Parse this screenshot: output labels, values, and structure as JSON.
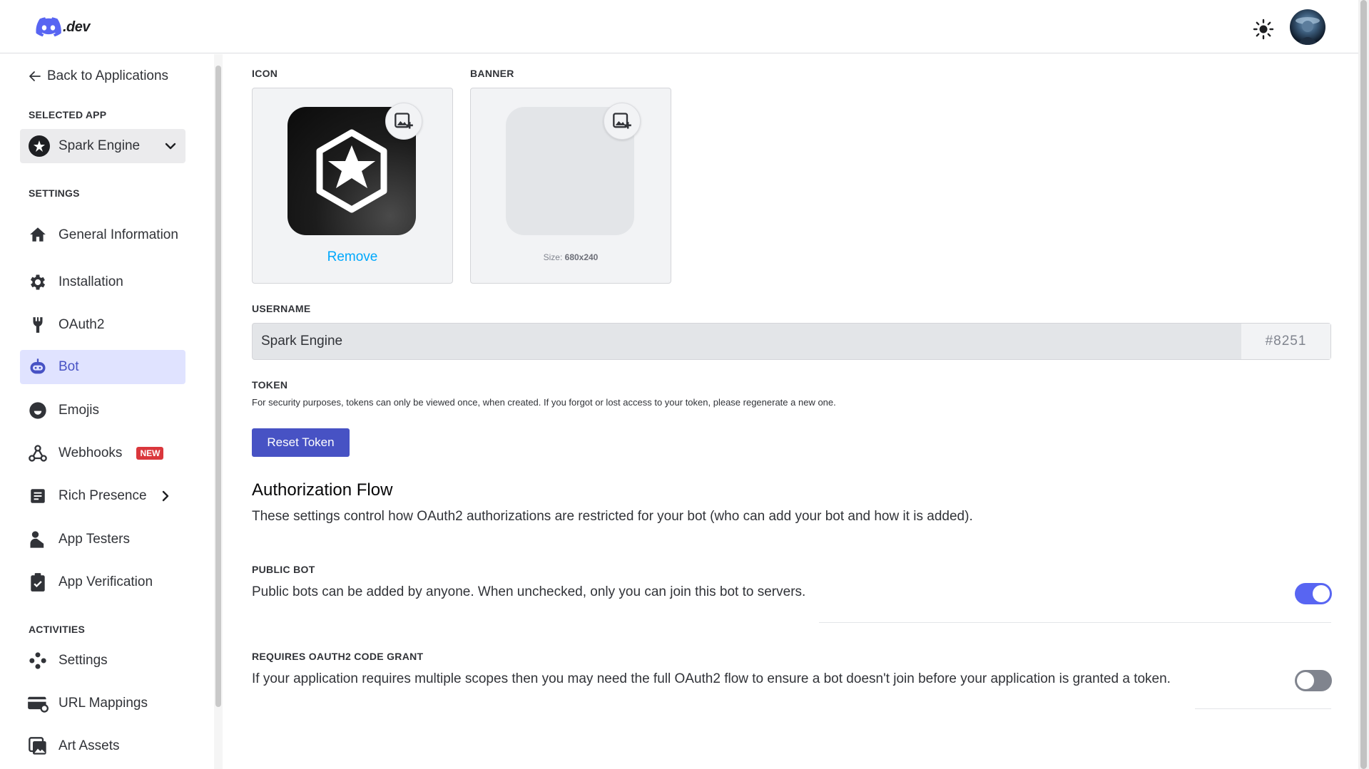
{
  "header": {
    "logo_text": ".dev"
  },
  "sidebar": {
    "back_label": "Back to Applications",
    "selected_app_label": "SELECTED APP",
    "selected_app_name": "Spark Engine",
    "settings_label": "SETTINGS",
    "activities_label": "ACTIVITIES",
    "items": [
      {
        "label": "General Information",
        "icon": "home-icon"
      },
      {
        "label": "Installation",
        "icon": "gear-icon"
      },
      {
        "label": "OAuth2",
        "icon": "wrench-icon"
      },
      {
        "label": "Bot",
        "icon": "bot-icon",
        "active": true
      },
      {
        "label": "Emojis",
        "icon": "smile-icon"
      },
      {
        "label": "Webhooks",
        "icon": "webhook-icon",
        "badge": "NEW"
      },
      {
        "label": "Rich Presence",
        "icon": "document-icon"
      },
      {
        "label": "App Testers",
        "icon": "person-icon"
      },
      {
        "label": "App Verification",
        "icon": "clipboard-check-icon"
      }
    ],
    "activity_items": [
      {
        "label": "Settings",
        "icon": "gamepad-icon"
      },
      {
        "label": "URL Mappings",
        "icon": "card-icon"
      },
      {
        "label": "Art Assets",
        "icon": "image-icon"
      }
    ]
  },
  "main": {
    "icon_label": "ICON",
    "banner_label": "BANNER",
    "remove_label": "Remove",
    "banner_size_prefix": "Size: ",
    "banner_size_value": "680x240",
    "username_label": "USERNAME",
    "username_value": "Spark Engine",
    "discriminator": "#8251",
    "token_label": "TOKEN",
    "token_desc": "For security purposes, tokens can only be viewed once, when created. If you forgot or lost access to your token, please regenerate a new one.",
    "reset_token_label": "Reset Token",
    "auth_flow_title": "Authorization Flow",
    "auth_flow_desc": "These settings control how OAuth2 authorizations are restricted for your bot (who can add your bot and how it is added).",
    "public_bot_label": "PUBLIC BOT",
    "public_bot_desc": "Public bots can be added by anyone. When unchecked, only you can join this bot to servers.",
    "public_bot_enabled": true,
    "code_grant_label": "REQUIRES OAUTH2 CODE GRANT",
    "code_grant_desc": "If your application requires multiple scopes then you may need the full OAuth2 flow to ensure a bot doesn't join before your application is granted a token.",
    "code_grant_enabled": false
  },
  "colors": {
    "accent": "#5865f2",
    "button": "#4752c4",
    "link": "#00a8fc",
    "badge": "#da373c"
  }
}
